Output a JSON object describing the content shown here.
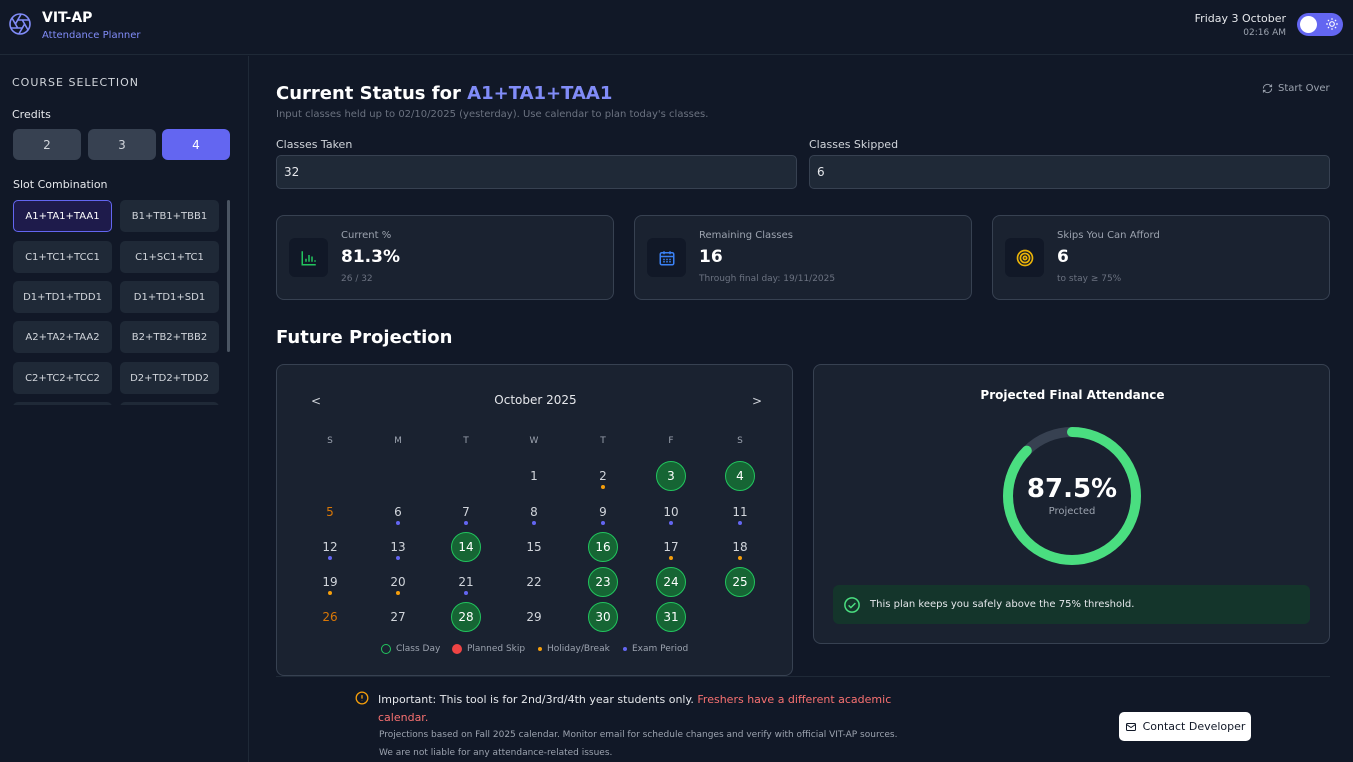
{
  "header": {
    "app_title": "VIT-AP",
    "app_subtitle": "Attendance Planner",
    "date": "Friday 3 October",
    "time": "02:16 AM"
  },
  "sidebar": {
    "heading": "COURSE SELECTION",
    "credits_label": "Credits",
    "credits": [
      "2",
      "3",
      "4"
    ],
    "selected_credit": "4",
    "slot_label": "Slot Combination",
    "slots": [
      "A1+TA1+TAA1",
      "B1+TB1+TBB1",
      "C1+TC1+TCC1",
      "C1+SC1+TC1",
      "D1+TD1+TDD1",
      "D1+TD1+SD1",
      "A2+TA2+TAA2",
      "B2+TB2+TBB2",
      "C2+TC2+TCC2",
      "D2+TD2+TDD2"
    ],
    "selected_slot": "A1+TA1+TAA1"
  },
  "status": {
    "title_prefix": "Current Status for",
    "slot": "A1+TA1+TAA1",
    "description": "Input classes held up to 02/10/2025 (yesterday). Use calendar to plan today's classes.",
    "start_over": "Start Over",
    "taken_label": "Classes Taken",
    "taken_value": "32",
    "skipped_label": "Classes Skipped",
    "skipped_value": "6"
  },
  "stats": {
    "current": {
      "label": "Current %",
      "value": "81.3%",
      "sub": "26 / 32",
      "icon": "bar-chart-icon",
      "color": "#22c55e"
    },
    "remaining": {
      "label": "Remaining Classes",
      "value": "16",
      "sub": "Through final day: 19/11/2025",
      "icon": "calendar-icon",
      "color": "#3b82f6"
    },
    "skips": {
      "label": "Skips You Can Afford",
      "value": "6",
      "sub": "to stay ≥ 75%",
      "icon": "target-icon",
      "color": "#eab308"
    }
  },
  "future": {
    "title": "Future Projection"
  },
  "calendar": {
    "prev": "<",
    "next": ">",
    "month": "October 2025",
    "weekdays": [
      "S",
      "M",
      "T",
      "W",
      "T",
      "F",
      "S"
    ],
    "first_weekday": 3,
    "days": [
      {
        "d": "1"
      },
      {
        "d": "2",
        "mark": "holiday"
      },
      {
        "d": "3",
        "class": true
      },
      {
        "d": "4",
        "class": true
      },
      {
        "d": "5",
        "weekend": true
      },
      {
        "d": "6",
        "mark": "exam"
      },
      {
        "d": "7",
        "mark": "exam"
      },
      {
        "d": "8",
        "mark": "exam"
      },
      {
        "d": "9",
        "mark": "exam"
      },
      {
        "d": "10",
        "mark": "exam"
      },
      {
        "d": "11",
        "mark": "exam"
      },
      {
        "d": "12",
        "mark": "exam"
      },
      {
        "d": "13",
        "mark": "exam"
      },
      {
        "d": "14",
        "class": true
      },
      {
        "d": "15"
      },
      {
        "d": "16",
        "class": true
      },
      {
        "d": "17",
        "mark": "holiday"
      },
      {
        "d": "18",
        "mark": "holiday"
      },
      {
        "d": "19",
        "mark": "holiday"
      },
      {
        "d": "20",
        "mark": "holiday"
      },
      {
        "d": "21",
        "mark": "exam"
      },
      {
        "d": "22"
      },
      {
        "d": "23",
        "class": true
      },
      {
        "d": "24",
        "class": true
      },
      {
        "d": "25",
        "class": true
      },
      {
        "d": "26",
        "weekend": true
      },
      {
        "d": "27"
      },
      {
        "d": "28",
        "class": true
      },
      {
        "d": "29"
      },
      {
        "d": "30",
        "class": true
      },
      {
        "d": "31",
        "class": true
      }
    ],
    "legend": {
      "class_day": "Class Day",
      "planned_skip": "Planned Skip",
      "holiday": "Holiday/Break",
      "exam": "Exam Period"
    }
  },
  "projection": {
    "title": "Projected Final Attendance",
    "value": "87.5%",
    "fraction": 0.875,
    "sub": "Projected",
    "message": "This plan keeps you safely above the 75% threshold."
  },
  "footer": {
    "important_lead": "Important: This tool is for 2nd/3rd/4th year students only.",
    "important_warn": "Freshers have a different academic calendar.",
    "note1": "Projections based on Fall 2025 calendar. Monitor email for schedule changes and verify with official VIT-AP sources.",
    "note2": "We are not liable for any attendance-related issues.",
    "contact": "Contact Developer"
  },
  "colors": {
    "accent": "#6366f1",
    "class_day": "#22c55e",
    "planned_skip": "#ef4444",
    "holiday": "#f59e0b",
    "exam": "#6366f1"
  }
}
